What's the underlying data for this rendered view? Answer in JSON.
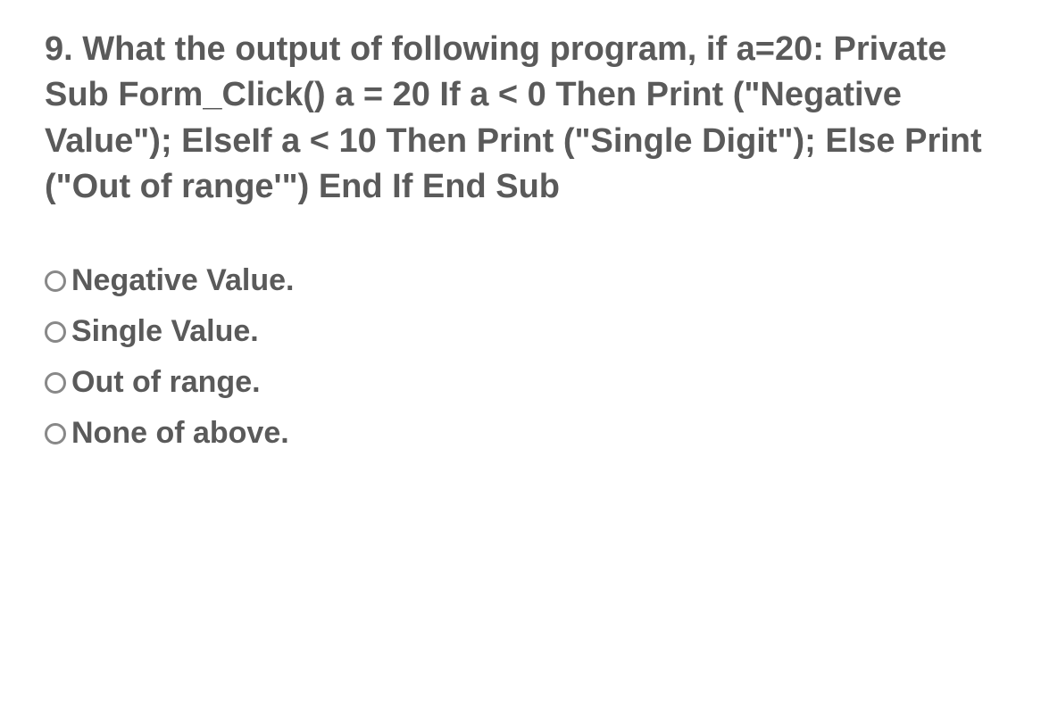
{
  "question": {
    "text": "9. What the output of following program, if a=20: Private Sub Form_Click() a = 20 If a < 0 Then Print (\"Negative Value\"); ElseIf a < 10 Then Print (\"Single Digit\"); Else Print (\"Out of range'\") End If End Sub"
  },
  "options": [
    {
      "label": "Negative Value."
    },
    {
      "label": "Single Value."
    },
    {
      "label": "Out of range."
    },
    {
      "label": "None of above."
    }
  ]
}
